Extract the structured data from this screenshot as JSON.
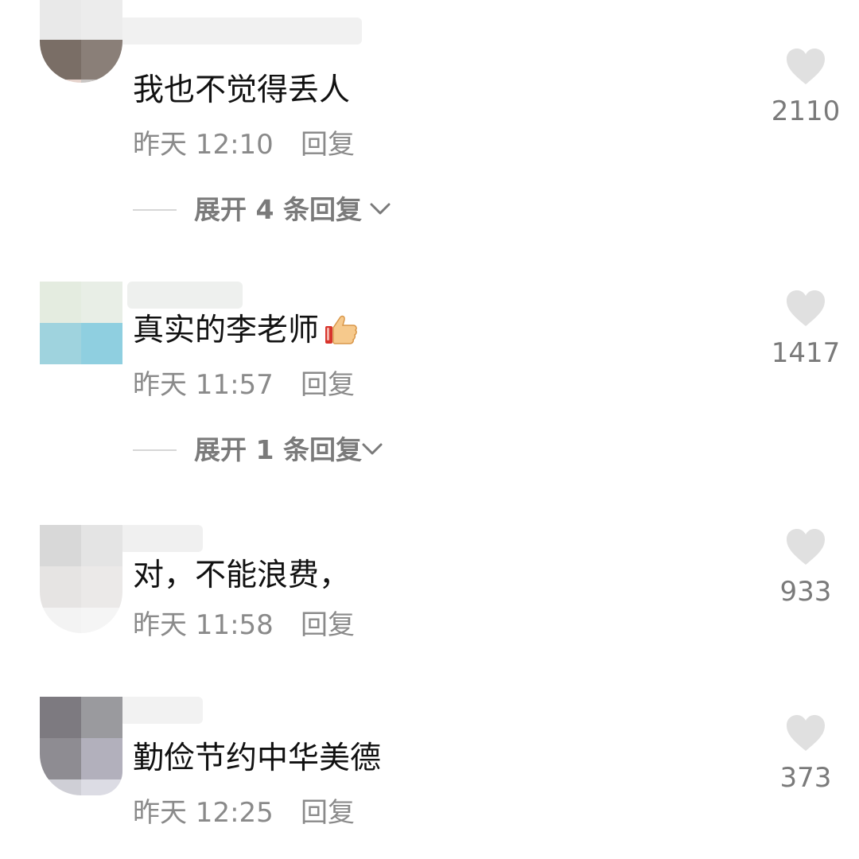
{
  "comments": [
    {
      "text": "我也不觉得丢人",
      "time": "昨天 12:10",
      "reply_label": "回复",
      "likes": "2110",
      "expand_label": "展开 4 条回复",
      "has_emoji": false
    },
    {
      "text": "真实的李老师",
      "time": "昨天 11:57",
      "reply_label": "回复",
      "likes": "1417",
      "expand_label": "展开 1 条回复",
      "has_emoji": true,
      "emoji": "thumbs-up"
    },
    {
      "text": "对，不能浪费，",
      "time": "昨天 11:58",
      "reply_label": "回复",
      "likes": "933",
      "has_emoji": false
    },
    {
      "text": "勤俭节约中华美德",
      "time": "昨天 12:25",
      "reply_label": "回复",
      "likes": "373",
      "has_emoji": false
    }
  ],
  "colors": {
    "text": "#111111",
    "meta": "#8a8a8a",
    "heart": "#e0e0e0",
    "line": "#d6d6d6"
  },
  "icons": {
    "like": "heart-icon",
    "expand": "chevron-down-icon",
    "emoji": "thumbs-up-icon"
  }
}
